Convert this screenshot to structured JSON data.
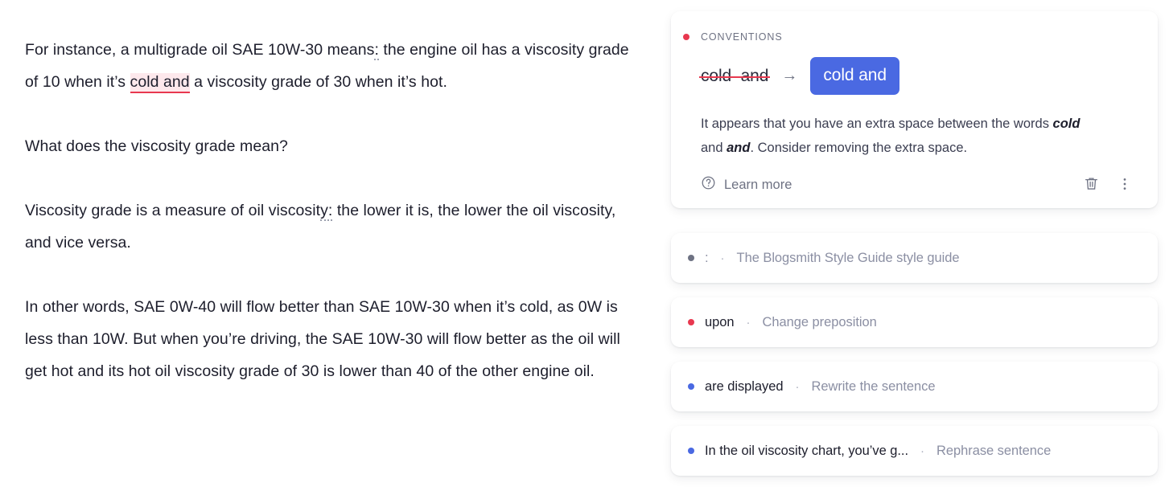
{
  "colors": {
    "accent_blue": "#4a69e2",
    "error_red": "#e8384f",
    "highlight_pink": "#fde8ec",
    "muted_gray": "#8b8fa3",
    "text_dark": "#1d1e2c"
  },
  "document": {
    "paragraphs": [
      {
        "id": "p1",
        "segments": [
          {
            "text": "For instance, a multigrade oil SAE 10W-30 means"
          },
          {
            "text": ":",
            "style": "dotted"
          },
          {
            "text": " the engine oil has a viscosity grade of 10 when it’s "
          },
          {
            "text": "cold  and",
            "style": "error"
          },
          {
            "text": " a viscosity grade of 30 when it’s hot."
          }
        ]
      },
      {
        "id": "p2",
        "segments": [
          {
            "text": "What does the viscosity grade mean?"
          }
        ]
      },
      {
        "id": "p3",
        "segments": [
          {
            "text": "Viscosity grade is a measure of oil viscosit"
          },
          {
            "text": "y:",
            "style": "dotted"
          },
          {
            "text": " the lower it is, the lower the oil viscosity, and vice versa."
          }
        ]
      },
      {
        "id": "p4",
        "segments": [
          {
            "text": "In other words, SAE 0W-40 will flow better than SAE 10W-30 when it’s cold, as 0W is less than 10W. But when you’re driving, the SAE 10W-30 will flow better as the oil will get hot and its hot oil viscosity grade of 30 is lower than 40 of the other engine oil."
          }
        ]
      }
    ]
  },
  "sidebar": {
    "main_card": {
      "category": "CONVENTIONS",
      "category_dot_color": "#e8384f",
      "original_text": "cold  and",
      "arrow_glyph": "→",
      "replacement_text": "cold and",
      "explanation_parts": [
        {
          "text": "It appears that you have an extra space between the words "
        },
        {
          "text": "cold",
          "style": "bold"
        },
        {
          "text": " and "
        },
        {
          "text": "and",
          "style": "bold"
        },
        {
          "text": ". Consider removing the extra space."
        }
      ],
      "learn_more_label": "Learn more",
      "help_icon": "question-circle-icon",
      "delete_icon": "trash-icon",
      "more_icon": "kebab-menu-icon"
    },
    "suggestions": [
      {
        "dot_color": "#6e7283",
        "text": ":",
        "muted": true,
        "separator": "·",
        "action": "The Blogsmith Style Guide style guide"
      },
      {
        "dot_color": "#e8384f",
        "text": "upon",
        "muted": false,
        "separator": "·",
        "action": "Change preposition"
      },
      {
        "dot_color": "#4a69e2",
        "text": "are displayed",
        "muted": false,
        "separator": "·",
        "action": "Rewrite the sentence"
      },
      {
        "dot_color": "#4a69e2",
        "text": "In the oil viscosity chart, you’ve g...",
        "muted": false,
        "separator": "·",
        "action": "Rephrase sentence"
      }
    ]
  }
}
